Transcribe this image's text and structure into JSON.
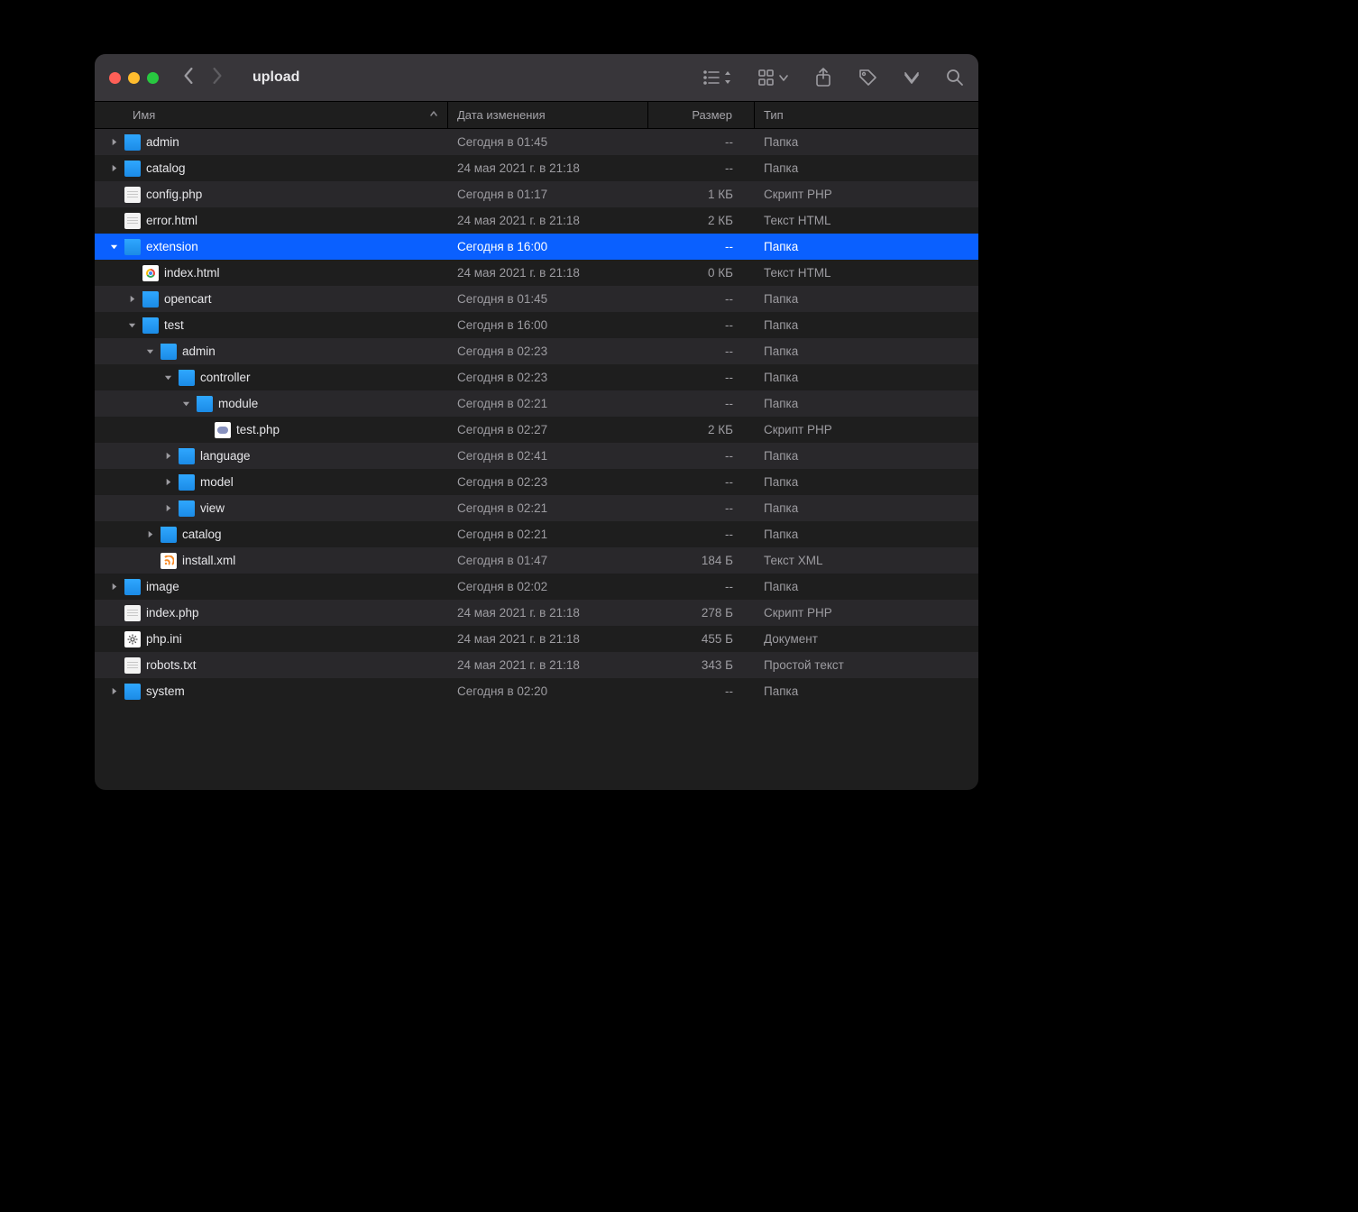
{
  "window": {
    "title": "upload"
  },
  "columns": {
    "name": "Имя",
    "modified": "Дата изменения",
    "size": "Размер",
    "type": "Тип",
    "sort_indicator": "ascending"
  },
  "rows": [
    {
      "depth": 0,
      "arrow": "right",
      "icon": "folder",
      "name": "admin",
      "modified": "Сегодня в 01:45",
      "size": "--",
      "type": "Папка"
    },
    {
      "depth": 0,
      "arrow": "right",
      "icon": "folder",
      "name": "catalog",
      "modified": "24 мая 2021 г. в 21:18",
      "size": "--",
      "type": "Папка"
    },
    {
      "depth": 0,
      "arrow": "none",
      "icon": "file-white",
      "name": "config.php",
      "modified": "Сегодня в 01:17",
      "size": "1 КБ",
      "type": "Скрипт PHP"
    },
    {
      "depth": 0,
      "arrow": "none",
      "icon": "file-white",
      "name": "error.html",
      "modified": "24 мая 2021 г. в 21:18",
      "size": "2 КБ",
      "type": "Текст HTML"
    },
    {
      "depth": 0,
      "arrow": "down",
      "icon": "folder",
      "name": "extension",
      "modified": "Сегодня в 16:00",
      "size": "--",
      "type": "Папка",
      "selected": true
    },
    {
      "depth": 1,
      "arrow": "none",
      "icon": "file-chrome",
      "name": "index.html",
      "modified": "24 мая 2021 г. в 21:18",
      "size": "0 КБ",
      "type": "Текст HTML"
    },
    {
      "depth": 1,
      "arrow": "right",
      "icon": "folder",
      "name": "opencart",
      "modified": "Сегодня в 01:45",
      "size": "--",
      "type": "Папка"
    },
    {
      "depth": 1,
      "arrow": "down",
      "icon": "folder",
      "name": "test",
      "modified": "Сегодня в 16:00",
      "size": "--",
      "type": "Папка"
    },
    {
      "depth": 2,
      "arrow": "down",
      "icon": "folder",
      "name": "admin",
      "modified": "Сегодня в 02:23",
      "size": "--",
      "type": "Папка"
    },
    {
      "depth": 3,
      "arrow": "down",
      "icon": "folder",
      "name": "controller",
      "modified": "Сегодня в 02:23",
      "size": "--",
      "type": "Папка"
    },
    {
      "depth": 4,
      "arrow": "down",
      "icon": "folder",
      "name": "module",
      "modified": "Сегодня в 02:21",
      "size": "--",
      "type": "Папка"
    },
    {
      "depth": 5,
      "arrow": "none",
      "icon": "file-php",
      "name": "test.php",
      "modified": "Сегодня в 02:27",
      "size": "2 КБ",
      "type": "Скрипт PHP"
    },
    {
      "depth": 3,
      "arrow": "right",
      "icon": "folder",
      "name": "language",
      "modified": "Сегодня в 02:41",
      "size": "--",
      "type": "Папка"
    },
    {
      "depth": 3,
      "arrow": "right",
      "icon": "folder",
      "name": "model",
      "modified": "Сегодня в 02:23",
      "size": "--",
      "type": "Папка"
    },
    {
      "depth": 3,
      "arrow": "right",
      "icon": "folder",
      "name": "view",
      "modified": "Сегодня в 02:21",
      "size": "--",
      "type": "Папка"
    },
    {
      "depth": 2,
      "arrow": "right",
      "icon": "folder",
      "name": "catalog",
      "modified": "Сегодня в 02:21",
      "size": "--",
      "type": "Папка"
    },
    {
      "depth": 2,
      "arrow": "none",
      "icon": "file-xml",
      "name": "install.xml",
      "modified": "Сегодня в 01:47",
      "size": "184 Б",
      "type": "Текст XML"
    },
    {
      "depth": 0,
      "arrow": "right",
      "icon": "folder",
      "name": "image",
      "modified": "Сегодня в 02:02",
      "size": "--",
      "type": "Папка"
    },
    {
      "depth": 0,
      "arrow": "none",
      "icon": "file-white",
      "name": "index.php",
      "modified": "24 мая 2021 г. в 21:18",
      "size": "278 Б",
      "type": "Скрипт PHP"
    },
    {
      "depth": 0,
      "arrow": "none",
      "icon": "file-gear",
      "name": "php.ini",
      "modified": "24 мая 2021 г. в 21:18",
      "size": "455 Б",
      "type": "Документ"
    },
    {
      "depth": 0,
      "arrow": "none",
      "icon": "file-white",
      "name": "robots.txt",
      "modified": "24 мая 2021 г. в 21:18",
      "size": "343 Б",
      "type": "Простой текст"
    },
    {
      "depth": 0,
      "arrow": "right",
      "icon": "folder",
      "name": "system",
      "modified": "Сегодня в 02:20",
      "size": "--",
      "type": "Папка"
    }
  ]
}
